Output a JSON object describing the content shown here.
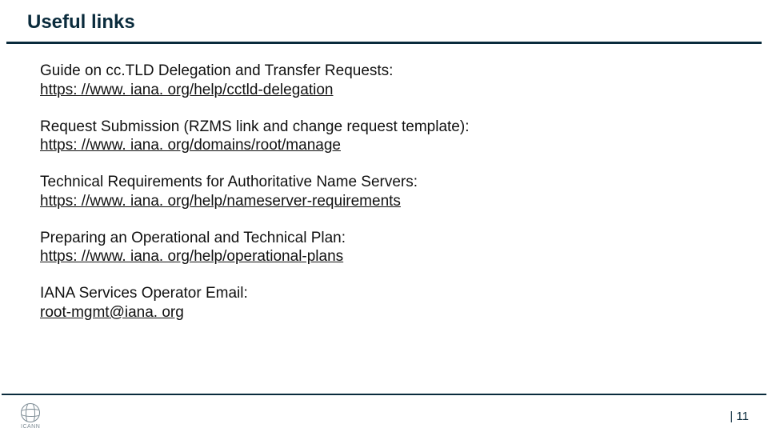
{
  "title": "Useful links",
  "items": [
    {
      "desc": "Guide on cc.TLD Delegation and Transfer Requests:",
      "link_text": "https: //www. iana. org/help/cctld-delegation"
    },
    {
      "desc": "Request Submission (RZMS link and change request template):",
      "link_text": "https: //www. iana. org/domains/root/manage"
    },
    {
      "desc": "Technical Requirements for Authoritative Name Servers:",
      "link_text": "https: //www. iana. org/help/nameserver-requirements"
    },
    {
      "desc": "Preparing an Operational and Technical Plan:",
      "link_text": "https: //www. iana. org/help/operational-plans"
    },
    {
      "desc": "IANA Services Operator Email:",
      "link_text": "root-mgmt@iana. org"
    }
  ],
  "footer": {
    "logo_label": "ICANN",
    "page_number": "| 11"
  },
  "colors": {
    "accent": "#0a2b3c",
    "muted": "#7b8a93"
  }
}
